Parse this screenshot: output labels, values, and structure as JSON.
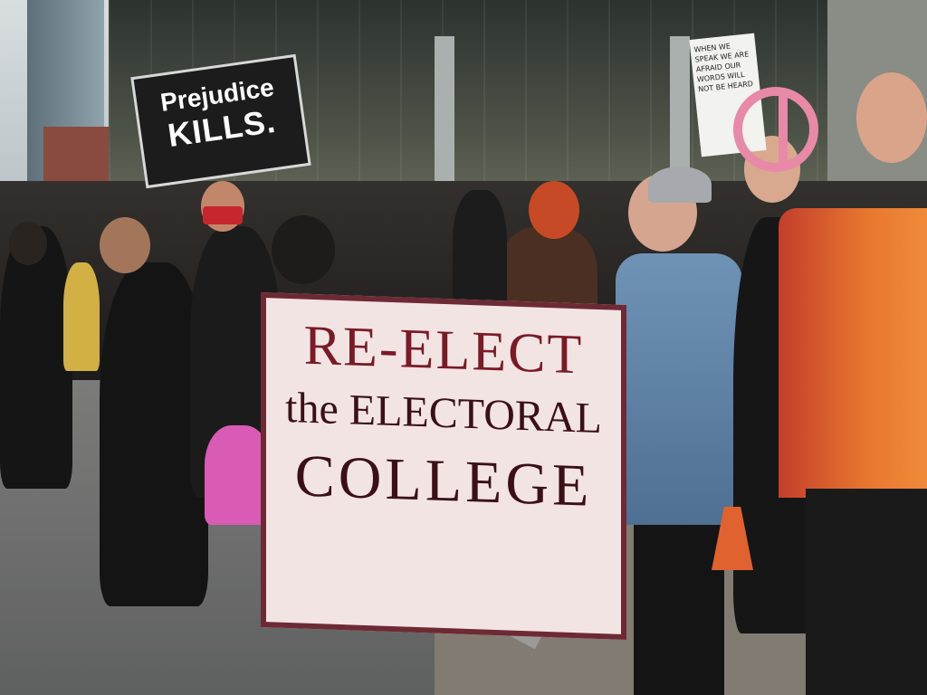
{
  "photo": {
    "signs": {
      "prejudice_sign": {
        "line1": "Prejudice",
        "line2": "KILLS."
      },
      "small_sign_text": "WHEN WE SPEAK WE ARE AFRAID OUR WORDS WILL NOT BE HEARD"
    },
    "banner": {
      "line1": "RE-ELECT",
      "line2": "the ELECTORAL",
      "line3": "COLLEGE",
      "color": "#6e2a34"
    }
  }
}
